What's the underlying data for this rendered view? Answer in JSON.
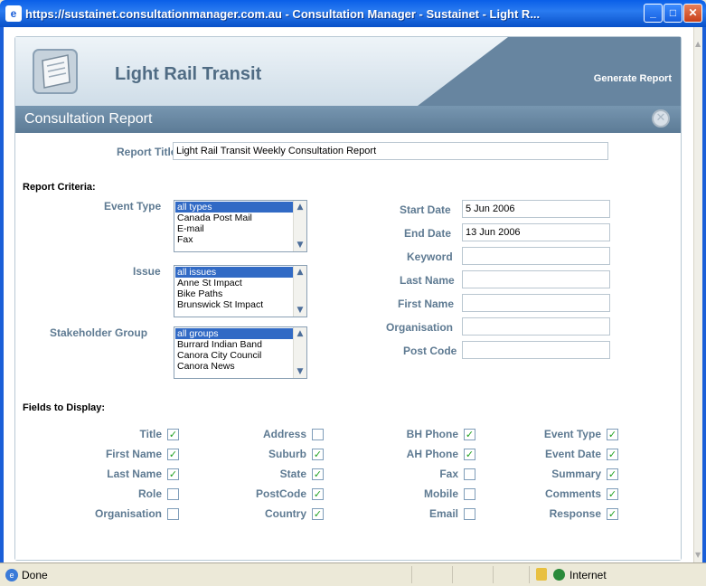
{
  "window": {
    "title": "https://sustainet.consultationmanager.com.au - Consultation Manager - Sustainet - Light R..."
  },
  "header": {
    "app_title": "Light Rail Transit",
    "generate_report": "Generate Report"
  },
  "bar": {
    "title": "Consultation Report"
  },
  "form": {
    "report_title_label": "Report Title",
    "report_title_value": "Light Rail Transit Weekly Consultation Report",
    "criteria_heading": "Report Criteria:",
    "event_type_label": "Event Type",
    "event_type_options": [
      "all types",
      "Canada Post Mail",
      "E-mail",
      "Fax"
    ],
    "issue_label": "Issue",
    "issue_options": [
      "all issues",
      "Anne St Impact",
      "Bike Paths",
      "Brunswick St Impact"
    ],
    "stakeholder_label": "Stakeholder Group",
    "stakeholder_options": [
      "all groups",
      "Burrard Indian Band",
      "Canora City Council",
      "Canora News"
    ],
    "start_date_label": "Start Date",
    "start_date_value": "5 Jun 2006",
    "end_date_label": "End Date",
    "end_date_value": "13 Jun 2006",
    "keyword_label": "Keyword",
    "keyword_value": "",
    "last_name_label": "Last Name",
    "last_name_value": "",
    "first_name_label": "First Name",
    "first_name_value": "",
    "organisation_label": "Organisation",
    "organisation_value": "",
    "post_code_label": "Post Code",
    "post_code_value": "",
    "fields_heading": "Fields to Display:",
    "fields": [
      [
        {
          "label": "Title",
          "checked": true
        },
        {
          "label": "First Name",
          "checked": true
        },
        {
          "label": "Last Name",
          "checked": true
        },
        {
          "label": "Role",
          "checked": false
        },
        {
          "label": "Organisation",
          "checked": false
        }
      ],
      [
        {
          "label": "Address",
          "checked": false
        },
        {
          "label": "Suburb",
          "checked": true
        },
        {
          "label": "State",
          "checked": true
        },
        {
          "label": "PostCode",
          "checked": true
        },
        {
          "label": "Country",
          "checked": true
        }
      ],
      [
        {
          "label": "BH Phone",
          "checked": true
        },
        {
          "label": "AH Phone",
          "checked": true
        },
        {
          "label": "Fax",
          "checked": false
        },
        {
          "label": "Mobile",
          "checked": false
        },
        {
          "label": "Email",
          "checked": false
        }
      ],
      [
        {
          "label": "Event Type",
          "checked": true
        },
        {
          "label": "Event Date",
          "checked": true
        },
        {
          "label": "Summary",
          "checked": true
        },
        {
          "label": "Comments",
          "checked": true
        },
        {
          "label": "Response",
          "checked": true
        }
      ]
    ]
  },
  "status": {
    "text": "Done",
    "zone": "Internet"
  },
  "colors": {
    "accent": "#5c7b96",
    "label": "#5e7a92",
    "check": "#21a121"
  },
  "icons": {
    "close": "close-icon",
    "logo": "document-logo-icon",
    "lock": "lock-icon",
    "globe": "internet-globe-icon"
  }
}
